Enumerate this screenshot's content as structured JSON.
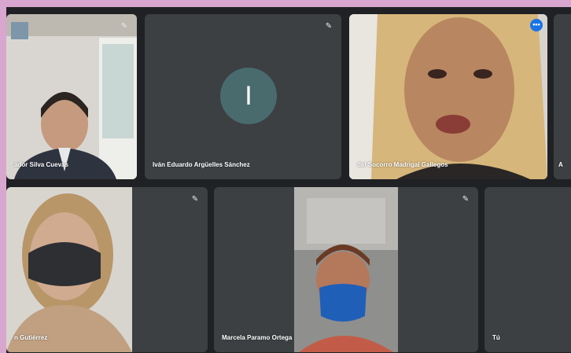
{
  "participants": [
    {
      "id": "p1",
      "name": "ador Silva Cuevas"
    },
    {
      "id": "p2",
      "name": "Iván Eduardo Argüelles Sánchez",
      "initial": "I"
    },
    {
      "id": "p3",
      "name": "del Socorro Madrigal Gallegos"
    },
    {
      "id": "p4",
      "name": "A"
    },
    {
      "id": "p5",
      "name": "n Gutiérrez"
    },
    {
      "id": "p6",
      "name": "Marcela Paramo Ortega"
    },
    {
      "id": "p7",
      "name": "Tú"
    }
  ],
  "icons": {
    "mic_off": "mic-off-icon",
    "more": "more-options-icon"
  },
  "colors": {
    "active_border": "#8ab4f8",
    "avatar_bg": "#4a6b6e",
    "tile_bg": "#3c4043",
    "stage_bg": "#202124",
    "frame": "#d9a6cf"
  }
}
